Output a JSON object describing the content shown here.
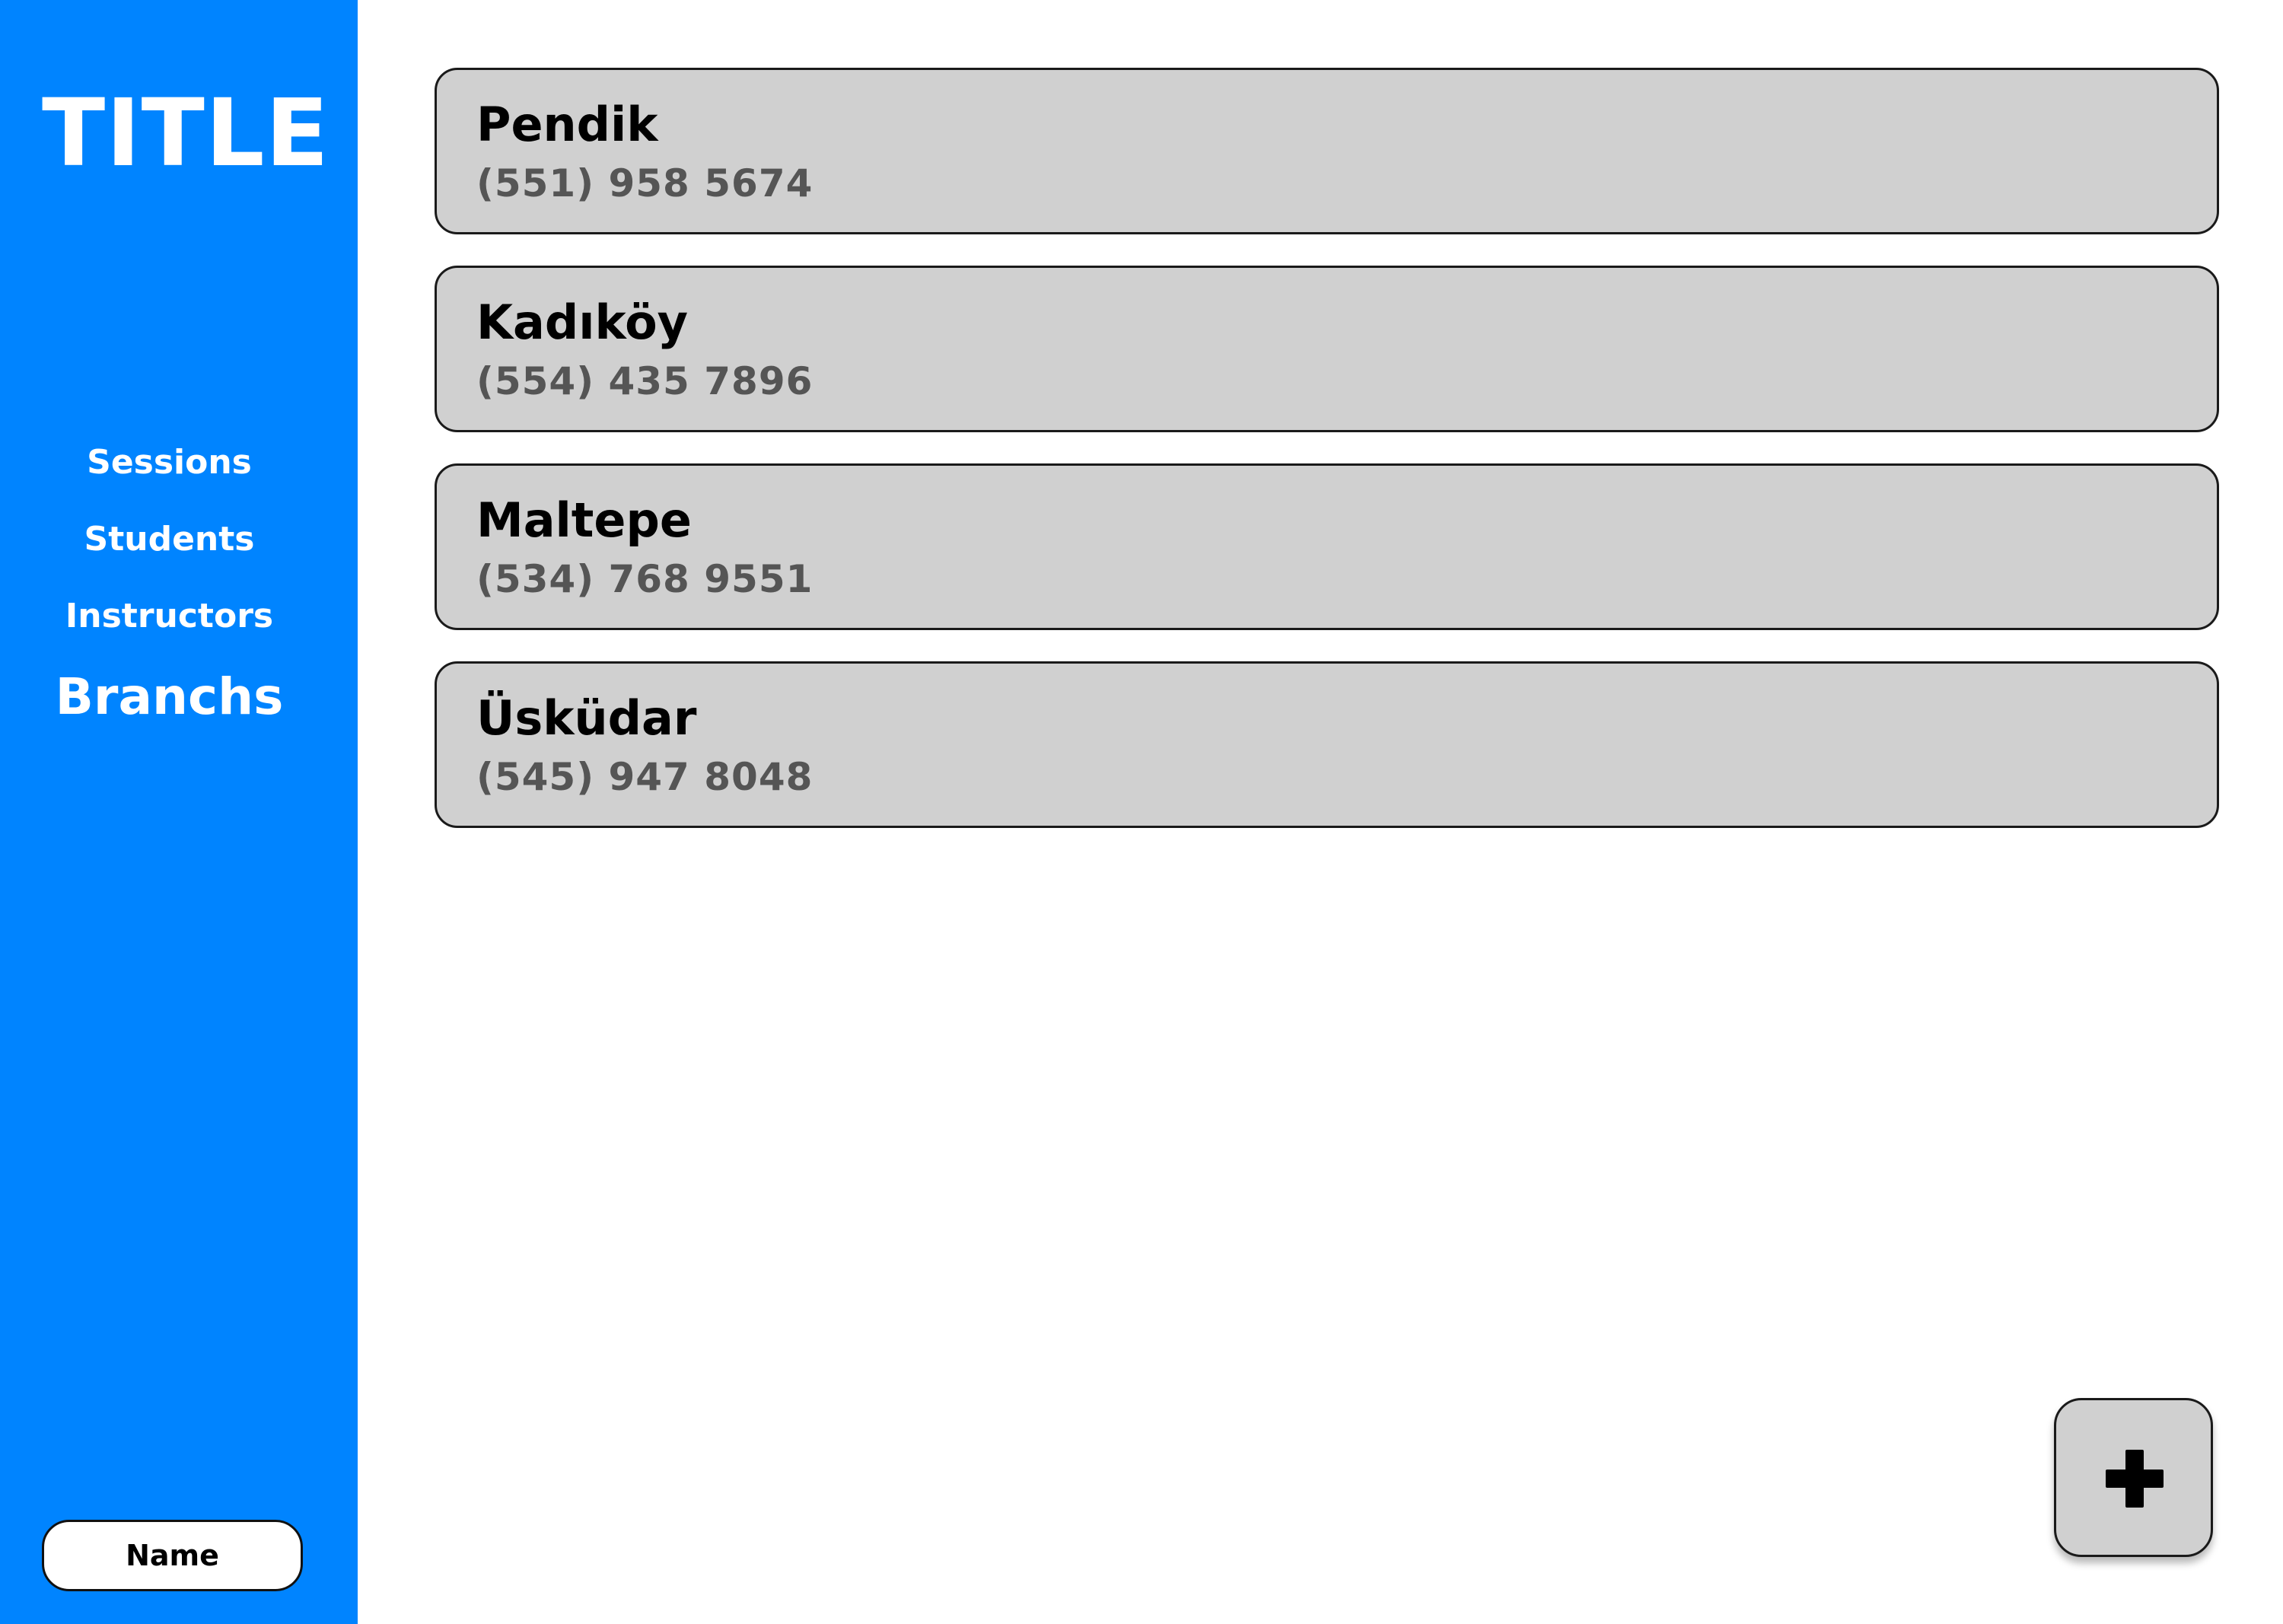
{
  "sidebar": {
    "title": "TITLE",
    "nav": [
      {
        "label": "Sessions",
        "active": false
      },
      {
        "label": "Students",
        "active": false
      },
      {
        "label": "Instructors",
        "active": false
      },
      {
        "label": "Branchs",
        "active": true
      }
    ],
    "user_button_label": "Name",
    "background_color": "#0084ff"
  },
  "branches": [
    {
      "name": "Pendik",
      "phone": "(551) 958 5674"
    },
    {
      "name": "Kadıköy",
      "phone": "(554) 435 7896"
    },
    {
      "name": "Maltepe",
      "phone": "(534) 768 9551"
    },
    {
      "name": "Üsküdar",
      "phone": "(545) 947 8048"
    }
  ],
  "add_button": {
    "icon": "plus-icon"
  },
  "colors": {
    "card_background": "#d0d0d0",
    "phone_text": "#555555"
  }
}
